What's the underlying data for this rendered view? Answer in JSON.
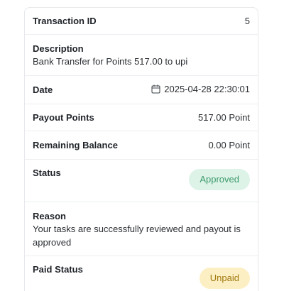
{
  "transaction": {
    "id_label": "Transaction ID",
    "id_value": "5",
    "description_label": "Description",
    "description_value": "Bank Transfer for Points 517.00 to upi",
    "date_label": "Date",
    "date_value": "2025-04-28 22:30:01",
    "payout_label": "Payout Points",
    "payout_value": "517.00 Point",
    "balance_label": "Remaining Balance",
    "balance_value": "0.00 Point",
    "status_label": "Status",
    "status_value": "Approved",
    "reason_label": "Reason",
    "reason_value": "Your tasks are successfully reviewed and payout is approved",
    "paid_status_label": "Paid Status",
    "paid_status_value": "Unpaid"
  },
  "icons": {
    "date_icon": "calendar-icon"
  },
  "colors": {
    "approved_bg": "#ddf3e8",
    "approved_text": "#3d9a6b",
    "unpaid_bg": "#fcefc4",
    "unpaid_text": "#a0790f"
  }
}
